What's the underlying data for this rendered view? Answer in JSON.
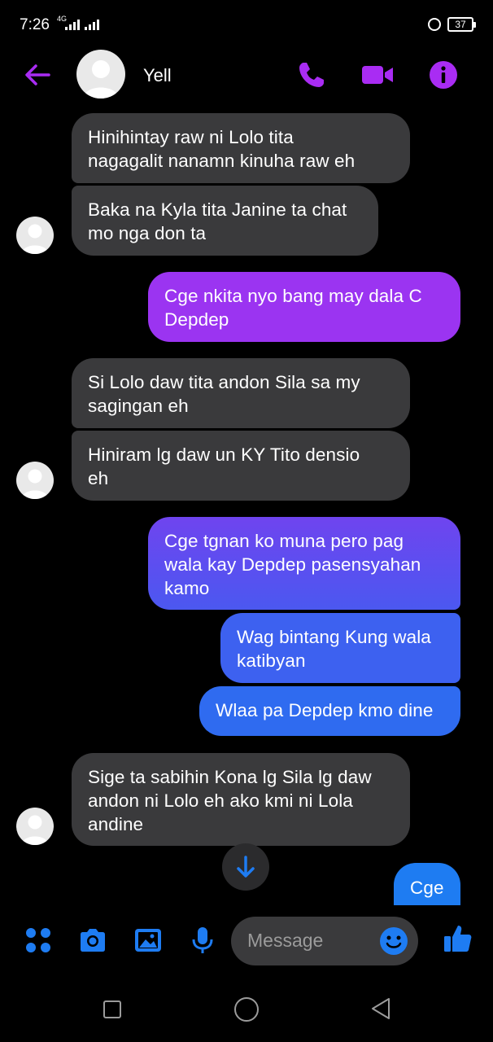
{
  "status_bar": {
    "time": "7:26",
    "network": "4G",
    "battery": "37"
  },
  "header": {
    "contact_name": "Yell",
    "accent_color": "#a92cf3"
  },
  "messages": [
    {
      "direction": "incoming",
      "text_lines": [
        "Hinihintay raw ni Lolo tita",
        "nagagalit nanamn kinuha raw eh"
      ]
    },
    {
      "direction": "incoming",
      "text_lines": [
        "Baka na Kyla tita Janine ta chat",
        "mo nga don ta"
      ]
    },
    {
      "direction": "outgoing",
      "text_lines": [
        "Cge nkita nyo bang may dala C",
        "Depdep"
      ]
    },
    {
      "direction": "incoming",
      "text_lines": [
        "Si Lolo daw tita andon Sila sa my",
        "sagingan eh"
      ]
    },
    {
      "direction": "incoming",
      "text_lines": [
        "Hiniram lg daw un KY Tito densio",
        "eh"
      ]
    },
    {
      "direction": "outgoing",
      "text_lines": [
        "Cge tgnan ko muna pero pag",
        "wala kay Depdep pasensyahan",
        "kamo"
      ]
    },
    {
      "direction": "outgoing",
      "text_lines": [
        "Wag bintang Kung wala",
        "katibyan"
      ]
    },
    {
      "direction": "outgoing",
      "text_lines": [
        "Wlaa pa Depdep kmo dine"
      ]
    },
    {
      "direction": "incoming",
      "text_lines": [
        "Sige ta sabihin Kona lg  Sila lg daw",
        "andon ni Lolo eh ako kmi ni Lola",
        "andine"
      ]
    },
    {
      "direction": "outgoing",
      "text_lines": [
        "Cge"
      ]
    }
  ],
  "composer": {
    "placeholder": "Message",
    "accent_color": "#1e7cf2"
  },
  "colors": {
    "incoming_bubble": "#3a3a3c",
    "outgoing_top": "#9b34f1",
    "outgoing_bottom": "#2f6bf0"
  }
}
